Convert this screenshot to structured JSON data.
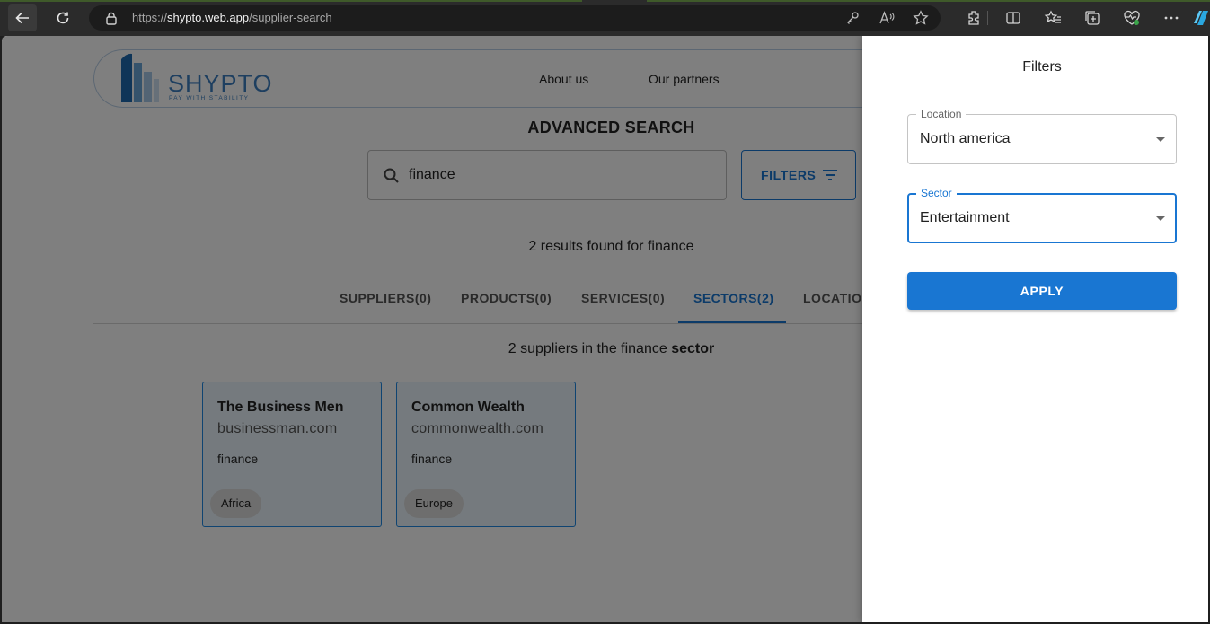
{
  "browser": {
    "url_prefix": "https://",
    "url_host": "shypto.web.app",
    "url_path": "/supplier-search"
  },
  "header": {
    "logo_text": "SHYPTO",
    "logo_tagline": "PAY WITH STABILITY",
    "nav": [
      "About us",
      "Our partners"
    ]
  },
  "main": {
    "title": "ADVANCED SEARCH",
    "search_value": "finance",
    "filters_label": "FILTERS",
    "results_text": "2 results found for finance",
    "tabs": [
      {
        "label": "SUPPLIERS(0)"
      },
      {
        "label": "PRODUCTS(0)"
      },
      {
        "label": "SERVICES(0)"
      },
      {
        "label": "SECTORS(2)"
      },
      {
        "label": "LOCATION"
      }
    ],
    "sector_summary_prefix": "2 suppliers in the finance ",
    "sector_summary_bold": "sector",
    "cards": [
      {
        "name": "The Business Men",
        "domain": "businessman.com",
        "sector": "finance",
        "location": "Africa"
      },
      {
        "name": "Common Wealth",
        "domain": "commonwealth.com",
        "sector": "finance",
        "location": "Europe"
      }
    ]
  },
  "drawer": {
    "title": "Filters",
    "location": {
      "label": "Location",
      "value": "North america"
    },
    "sector": {
      "label": "Sector",
      "value": "Entertainment"
    },
    "apply_label": "APPLY"
  },
  "colors": {
    "primary": "#1976d2",
    "logo_blue": "#3c7fc0",
    "card_bg": "#eaf5fc"
  }
}
